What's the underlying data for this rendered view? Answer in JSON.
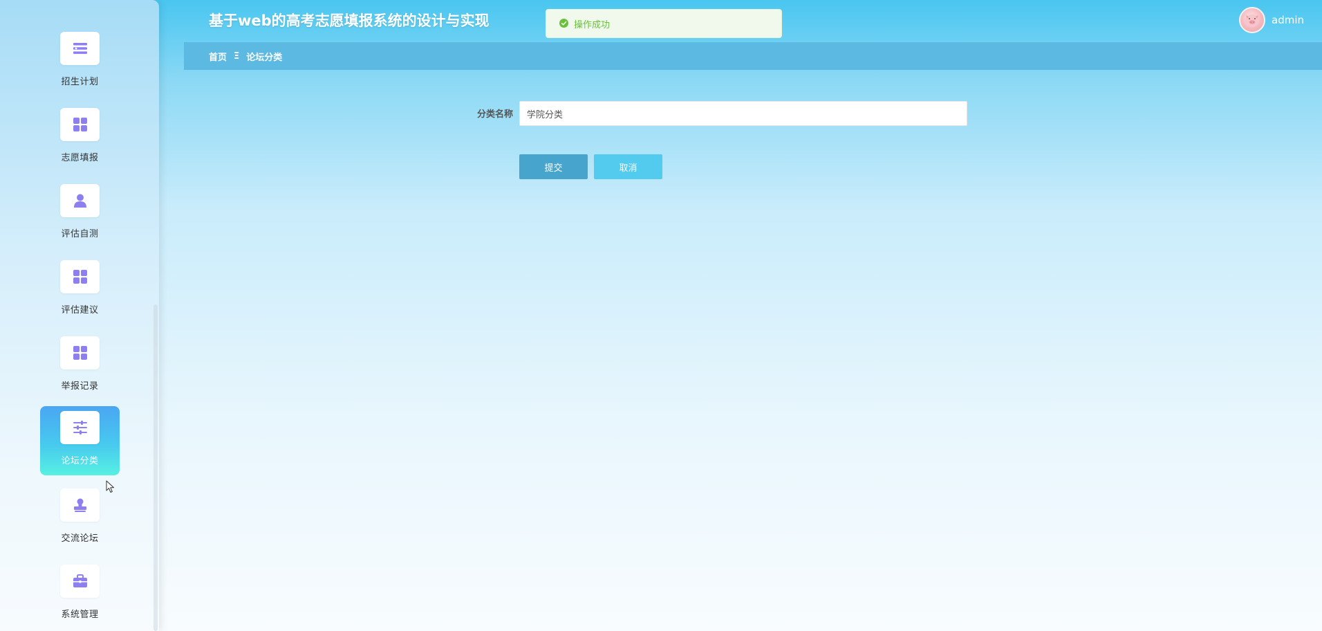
{
  "app": {
    "title": "基于web的高考志愿填报系统的设计与实现"
  },
  "toast": {
    "icon": "check-circle-icon",
    "message": "操作成功",
    "color": "#67c23a"
  },
  "user": {
    "name": "admin",
    "avatar_icon": "pig-avatar-icon"
  },
  "breadcrumb": {
    "home": "首页",
    "separator": "Ξ",
    "current": "论坛分类"
  },
  "sidebar": {
    "items": [
      {
        "label": "招生计划",
        "icon": "list-icon",
        "active": false
      },
      {
        "label": "志愿填报",
        "icon": "grid-icon",
        "active": false
      },
      {
        "label": "评估自测",
        "icon": "user-icon",
        "active": false
      },
      {
        "label": "评估建议",
        "icon": "grid-icon",
        "active": false
      },
      {
        "label": "举报记录",
        "icon": "grid-icon",
        "active": false
      },
      {
        "label": "论坛分类",
        "icon": "sliders-icon",
        "active": true
      },
      {
        "label": "交流论坛",
        "icon": "stamp-icon",
        "active": false
      },
      {
        "label": "系统管理",
        "icon": "briefcase-icon",
        "active": false
      }
    ]
  },
  "form": {
    "category_label": "分类名称",
    "category_value": "学院分类",
    "submit_label": "提交",
    "cancel_label": "取消"
  },
  "colors": {
    "accent": "#49c6f0",
    "icon": "#8d7ff0",
    "breadcrumb_bg": "#5bb9e2",
    "submit_bg": "#47a5cd",
    "cancel_bg": "#52cbef"
  }
}
